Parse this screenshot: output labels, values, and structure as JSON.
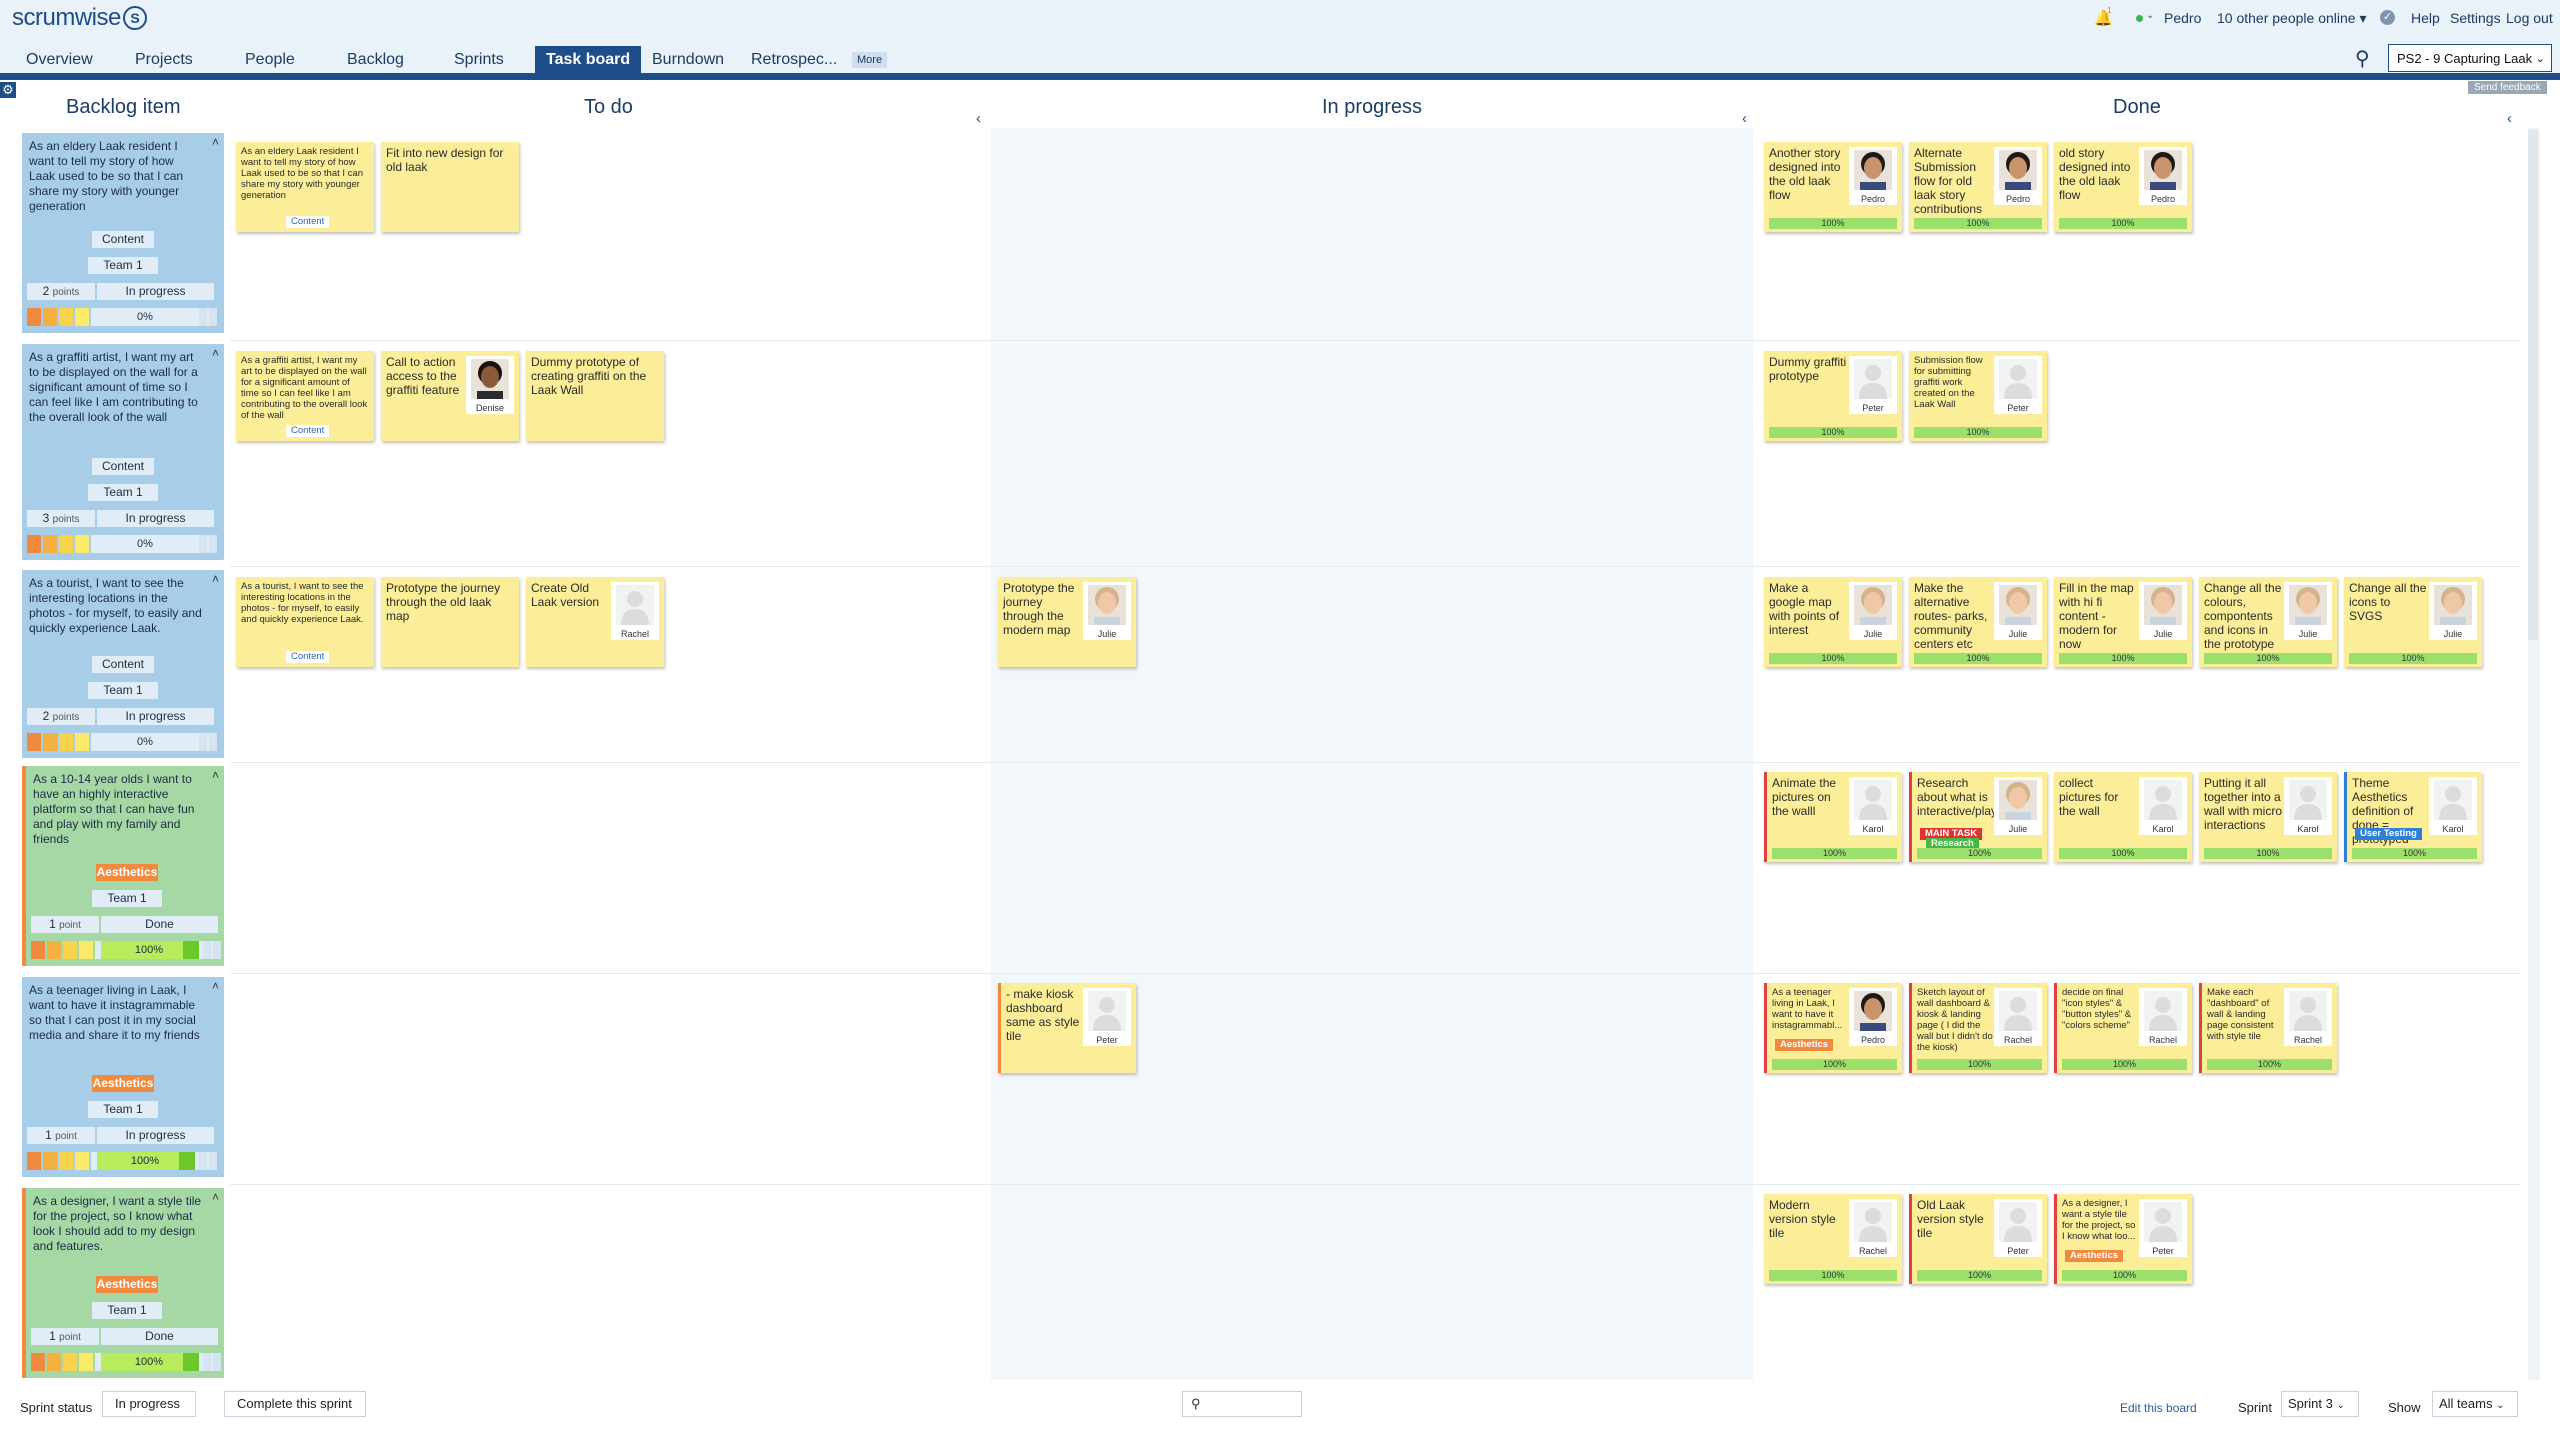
{
  "app": {
    "logo_text": "scrumwise",
    "notification_count": "1",
    "user_name": "Pedro",
    "online_text": "10 other people online",
    "help_label": "Help",
    "settings_label": "Settings",
    "logout_label": "Log out"
  },
  "nav": {
    "tabs": [
      "Overview",
      "Projects",
      "People",
      "Backlog",
      "Sprints",
      "Task board",
      "Burndown",
      "Retrospec..."
    ],
    "more_label": "More",
    "active_tab": "Task board",
    "sprint_select": "PS2 - 9 Capturing Laak",
    "send_feedback": "Send feedback"
  },
  "columns": {
    "backlog": "Backlog item",
    "todo": "To do",
    "in_progress": "In progress",
    "done": "Done"
  },
  "colors": {
    "primary": "#1d4e89",
    "card_yellow": "#fcee98",
    "backlog_blue": "#a8cde9",
    "backlog_green": "#a5d8a5",
    "progress_green": "#9be06b",
    "tag_orange": "#f08a3e"
  },
  "backlog_items": [
    {
      "text": "As an eldery Laak resident I want to tell my story of how Laak used to be so that I can share my story with younger generation",
      "tag": "Content",
      "team": "Team 1",
      "points": "2",
      "points_unit": "points",
      "status": "In progress",
      "progress": "0%",
      "progress_value": 0
    },
    {
      "text": "As a graffiti artist, I want my art to be displayed on the wall for a significant amount of time so I can feel like I am contributing to the overall look of the wall",
      "tag": "Content",
      "team": "Team 1",
      "points": "3",
      "points_unit": "points",
      "status": "In progress",
      "progress": "0%",
      "progress_value": 0
    },
    {
      "text": "As a tourist, I want to see the interesting locations in the photos - for myself, to easily and quickly experience Laak.",
      "tag": "Content",
      "team": "Team 1",
      "points": "2",
      "points_unit": "points",
      "status": "In progress",
      "progress": "0%",
      "progress_value": 0
    },
    {
      "text": "As a 10-14 year olds I want to have an highly interactive platform so that I can have fun and play with my family and friends",
      "tag": "Aesthetics",
      "team": "Team 1",
      "points": "1",
      "points_unit": "point",
      "status": "Done",
      "progress": "100%",
      "progress_value": 1
    },
    {
      "text": "As a teenager living in Laak, I want to have it instagrammable so that I can post it in my social media and share it to my friends",
      "tag": "Aesthetics",
      "team": "Team 1",
      "points": "1",
      "points_unit": "point",
      "status": "In progress",
      "progress": "100%",
      "progress_value": 1
    },
    {
      "text": "As a designer, I want a style tile for the project, so I know what look I should add to my design and features.",
      "tag": "Aesthetics",
      "team": "Team 1",
      "points": "1",
      "points_unit": "point",
      "status": "Done",
      "progress": "100%",
      "progress_value": 1
    }
  ],
  "cards": {
    "todo": [
      [
        {
          "text": "As an eldery Laak resident I want to tell my story of how Laak used to be so that I can share my story with younger generation",
          "tag": "Content"
        },
        {
          "text": "Fit into new design for old laak"
        }
      ],
      [
        {
          "text": "As a graffiti artist, I want my art to be displayed on the wall for a significant amount of time so I can feel like I am contributing to the overall look of the wall",
          "tag": "Content"
        },
        {
          "text": "Call to action access to the graffiti feature",
          "assignee": "Denise"
        },
        {
          "text": "Dummy prototype of creating graffiti on the Laak Wall"
        }
      ],
      [
        {
          "text": "As a tourist, I want to see the interesting locations in the photos - for myself, to easily and quickly experience Laak.",
          "tag": "Content"
        },
        {
          "text": "Prototype the journey through the old laak map"
        },
        {
          "text": "Create Old Laak version",
          "assignee": "Rachel"
        }
      ],
      [],
      [],
      []
    ],
    "in_progress": [
      [],
      [],
      [
        {
          "text": "Prototype the journey through the modern map",
          "assignee": "Julie"
        }
      ],
      [],
      [
        {
          "text": "- make kiosk dashboard same as style tile",
          "assignee": "Peter"
        }
      ],
      []
    ],
    "done": [
      [
        {
          "text": "Another story designed into the old laak flow",
          "assignee": "Pedro",
          "progress": "100%"
        },
        {
          "text": "Alternate Submission flow for old laak story contributions",
          "assignee": "Pedro",
          "progress": "100%"
        },
        {
          "text": "old story designed into the old laak flow",
          "assignee": "Pedro",
          "progress": "100%"
        }
      ],
      [
        {
          "text": "Dummy graffiti prototype",
          "assignee": "Peter",
          "progress": "100%"
        },
        {
          "text": "Submission flow for submitting graffiti work created on the Laak Wall",
          "assignee": "Peter",
          "progress": "100%"
        }
      ],
      [
        {
          "text": "Make a google map with points of interest",
          "assignee": "Julie",
          "progress": "100%"
        },
        {
          "text": "Make the alternative routes- parks, community centers etc",
          "assignee": "Julie",
          "progress": "100%"
        },
        {
          "text": "Fill in the map with hi fi content - modern for now",
          "assignee": "Julie",
          "progress": "100%"
        },
        {
          "text": "Change all the colours, compontents and icons in the prototype",
          "assignee": "Julie",
          "progress": "100%"
        },
        {
          "text": "Change all the icons to SVGS",
          "assignee": "Julie",
          "progress": "100%"
        }
      ],
      [
        {
          "text": "Animate the pictures on the walll",
          "assignee": "Karol",
          "progress": "100%"
        },
        {
          "text": "Research about what is interactive/play...",
          "tag": "MAIN TASK",
          "tag2": "Research",
          "assignee": "Julie",
          "progress": "100%"
        },
        {
          "text": "collect pictures for the wall",
          "assignee": "Karol",
          "progress": "100%"
        },
        {
          "text": "Putting it all together into a wall with micro interactions",
          "assignee": "Karol",
          "progress": "100%"
        },
        {
          "text": "Theme Aesthetics definition of done = prototyped and...",
          "tag": "User Testing",
          "assignee": "Karol",
          "progress": "100%"
        }
      ],
      [
        {
          "text": "As a teenager living in Laak, I want to have it instagrammabl...",
          "tag": "Aesthetics",
          "assignee": "Pedro",
          "progress": "100%"
        },
        {
          "text": "Sketch layout of wall dashboard & kiosk & landing page ( I did the wall but I didn't do the kiosk)",
          "assignee": "Rachel",
          "progress": "100%"
        },
        {
          "text": "decide on final \"icon styles\" & \"button styles\" & \"colors scheme\"",
          "assignee": "Rachel",
          "progress": "100%"
        },
        {
          "text": "Make each \"dashboard\" of wall & landing page consistent with style tile",
          "assignee": "Rachel",
          "progress": "100%"
        }
      ],
      [
        {
          "text": "Modern version style tile",
          "assignee": "Rachel",
          "progress": "100%"
        },
        {
          "text": "Old Laak version style tile",
          "assignee": "Peter",
          "progress": "100%"
        },
        {
          "text": "As a designer, I want a style tile for the project, so I know what loo...",
          "tag": "Aesthetics",
          "assignee": "Peter",
          "progress": "100%"
        }
      ]
    ]
  },
  "footer": {
    "sprint_status_label": "Sprint status",
    "sprint_status_value": "In progress",
    "complete_sprint": "Complete this sprint",
    "edit_board": "Edit this board",
    "sprint_label": "Sprint",
    "sprint_value": "Sprint 3",
    "show_label": "Show",
    "show_value": "All teams"
  }
}
